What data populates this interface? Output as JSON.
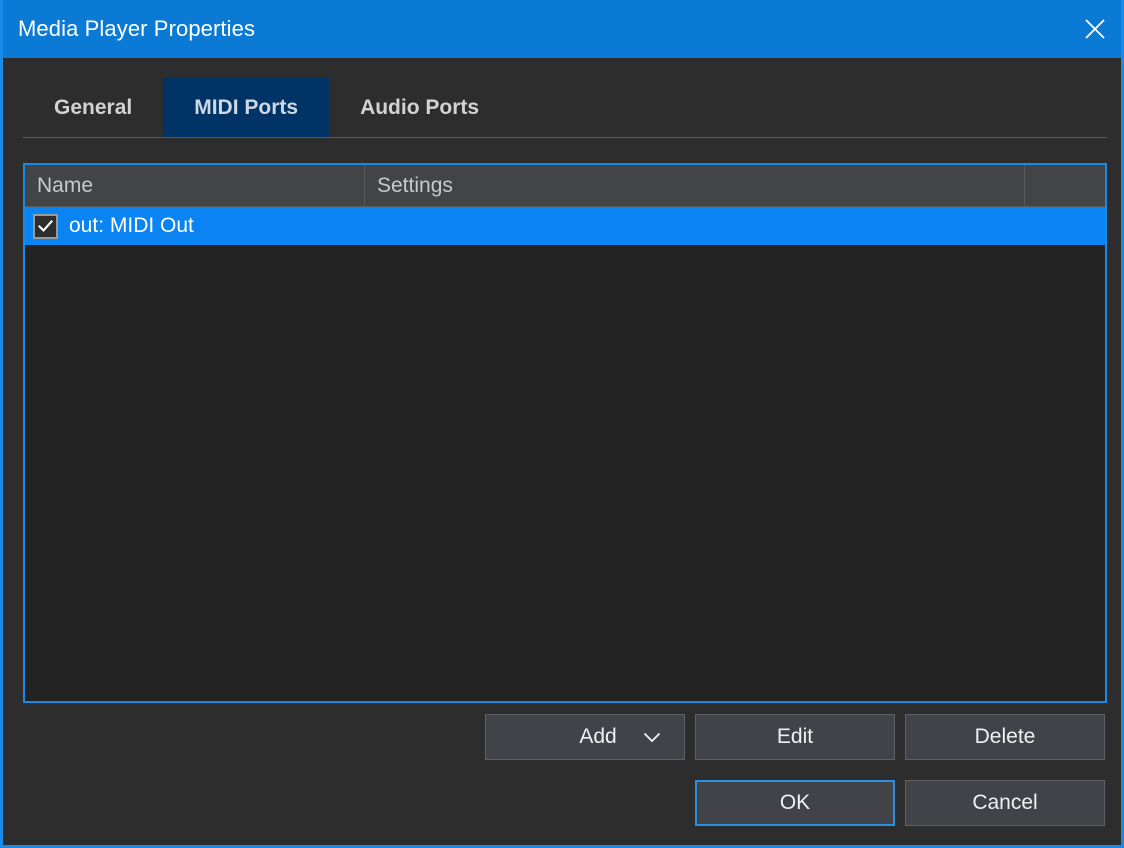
{
  "window": {
    "title": "Media Player Properties",
    "close_icon": "close-icon",
    "accent_color": "#1a8ae8",
    "titlebar_color": "#0b7ad4",
    "background_color": "#2d2d2d"
  },
  "tabs": {
    "selected": "MIDI Ports",
    "items": [
      {
        "label": "General",
        "selected": false
      },
      {
        "label": "MIDI Ports",
        "selected": true
      },
      {
        "label": "Audio Ports",
        "selected": false
      }
    ],
    "selected_color": "#003366"
  },
  "list": {
    "columns": [
      {
        "label": "Name"
      },
      {
        "label": "Settings"
      },
      {
        "label": ""
      }
    ],
    "rows": [
      {
        "checked": true,
        "name": "out: MIDI Out",
        "settings": "",
        "selected": true
      }
    ],
    "selection_color": "#0984f2",
    "border_color": "#1a8ae8"
  },
  "buttons": {
    "add": {
      "label": "Add",
      "dropdown_icon": "chevron-down-icon"
    },
    "edit": {
      "label": "Edit"
    },
    "delete": {
      "label": "Delete"
    },
    "ok": {
      "label": "OK",
      "focused": true
    },
    "cancel": {
      "label": "Cancel"
    }
  }
}
